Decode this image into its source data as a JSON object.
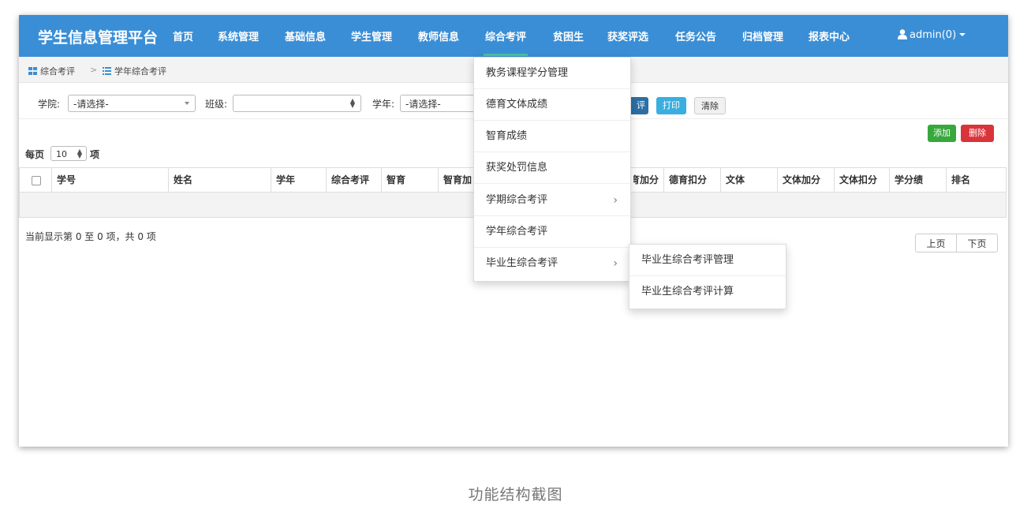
{
  "navbar": {
    "brand": "学生信息管理平台",
    "items": [
      "首页",
      "系统管理",
      "基础信息",
      "学生管理",
      "教师信息",
      "综合考评",
      "贫困生",
      "获奖评选",
      "任务公告",
      "归档管理",
      "报表中心"
    ],
    "active_index": 5,
    "user": "admin(0)"
  },
  "breadcrumb": {
    "parent": "综合考评",
    "separator": ">",
    "current": "学年综合考评"
  },
  "filters": {
    "college_label": "学院:",
    "college_value": "-请选择-",
    "class_label": "班级:",
    "class_value": "",
    "year_label": "学年:",
    "year_value": "-请选择-"
  },
  "buttons": {
    "evaluate": "评",
    "print": "打印",
    "clear": "清除",
    "add": "添加",
    "delete": "删除"
  },
  "page_length": {
    "prefix": "每页",
    "value": "10",
    "suffix": "项"
  },
  "table": {
    "columns": [
      "学号",
      "姓名",
      "学年",
      "综合考评",
      "智育",
      "智育加",
      "",
      "德育加分",
      "德育扣分",
      "文体",
      "文体加分",
      "文体扣分",
      "学分绩",
      "排名"
    ]
  },
  "info": "当前显示第 0 至 0 项，共 0 项",
  "pagination": {
    "prev": "上页",
    "next": "下页"
  },
  "dropdown": {
    "items": [
      "教务课程学分管理",
      "德育文体成绩",
      "智育成绩",
      "获奖处罚信息",
      "学期综合考评",
      "学年综合考评",
      "毕业生综合考评"
    ],
    "submenu": [
      "毕业生综合考评管理",
      "毕业生综合考评计算"
    ]
  },
  "caption": "功能结构截图",
  "colors": {
    "navbar": "#3a8ed6",
    "active_underline": "#4cc29b",
    "success": "#38a83d",
    "danger": "#d9343a",
    "info": "#3aaee0"
  }
}
